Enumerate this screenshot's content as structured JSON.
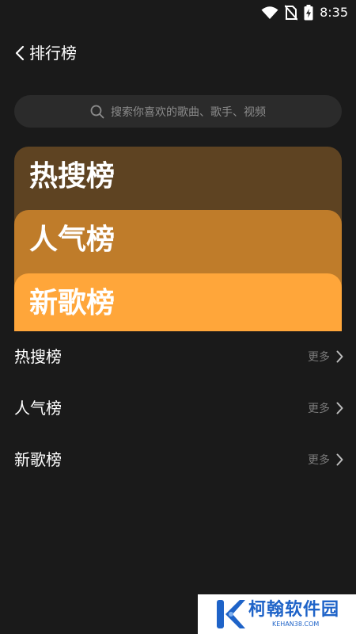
{
  "status_bar": {
    "time": "8:35",
    "icons": [
      "wifi-icon",
      "no-sim-icon",
      "battery-charging-icon"
    ]
  },
  "header": {
    "back_icon": "chevron-left-icon",
    "title": "排行榜"
  },
  "search": {
    "icon": "search-icon",
    "placeholder": "搜索你喜欢的歌曲、歌手、视频"
  },
  "cards": [
    {
      "title": "热搜榜",
      "color": "#5e4322"
    },
    {
      "title": "人气榜",
      "color": "#bf7c2a"
    },
    {
      "title": "新歌榜",
      "color": "#ffa63a"
    }
  ],
  "ranks": [
    {
      "name": "热搜榜",
      "more": "更多"
    },
    {
      "name": "人气榜",
      "more": "更多"
    },
    {
      "name": "新歌榜",
      "more": "更多"
    }
  ],
  "watermark": {
    "text": "柯翰软件园",
    "sub": "KEHAN38.COM"
  },
  "colors": {
    "background": "#1a1a1a",
    "search_bg": "#2b2b2b",
    "muted_text": "#7a7a7a",
    "watermark_blue": "#1e63c8"
  }
}
